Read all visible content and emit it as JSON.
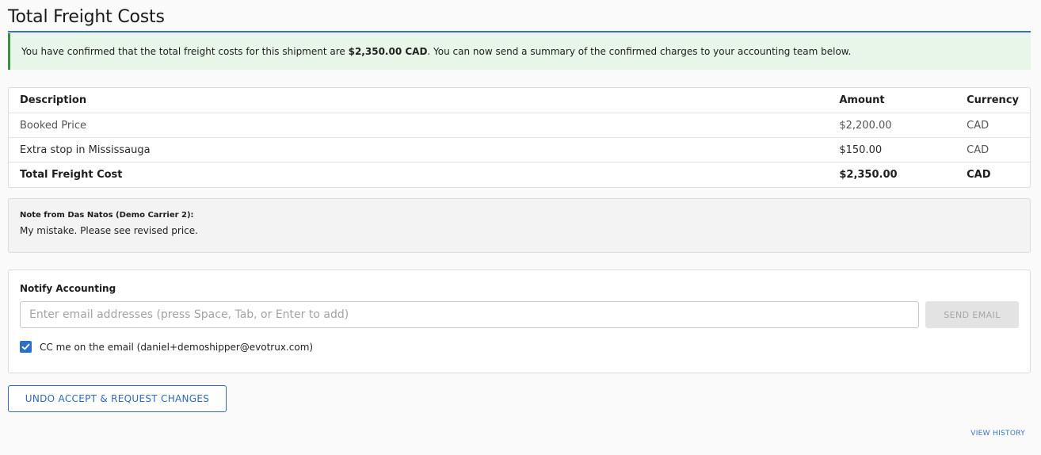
{
  "header": {
    "title": "Total Freight Costs"
  },
  "alert": {
    "text_before": "You have confirmed that the total freight costs for this shipment are ",
    "total_bold": "$2,350.00 CAD",
    "text_after": ". You can now send a summary of the confirmed charges to your accounting team below."
  },
  "cost_table": {
    "headers": [
      "Description",
      "Amount",
      "Currency"
    ],
    "rows": [
      {
        "description": "Booked Price",
        "amount": "$2,200.00",
        "currency": "CAD"
      },
      {
        "description": "Extra stop in Mississauga",
        "amount": "$150.00",
        "currency": "CAD"
      }
    ],
    "total": {
      "description": "Total Freight Cost",
      "amount": "$2,350.00",
      "currency": "CAD"
    }
  },
  "note": {
    "heading": "Note from Das Natos (Demo Carrier 2):",
    "text": "My mistake.  Please see revised price."
  },
  "notify": {
    "heading": "Notify Accounting",
    "email_placeholder": "Enter email addresses (press Space, Tab, or Enter to add)",
    "email_value": "",
    "send_label": "SEND EMAIL",
    "cc_label": "CC me on the email (daniel+demoshipper@evotrux.com)",
    "cc_checked": true
  },
  "actions": {
    "undo_label": "UNDO ACCEPT & REQUEST CHANGES",
    "history_label": "VIEW HISTORY"
  },
  "colors": {
    "accent": "#2b70c9",
    "success_bg": "#e8f5e9",
    "success_border": "#3e8e41",
    "title_rule": "#3a6fc9"
  }
}
